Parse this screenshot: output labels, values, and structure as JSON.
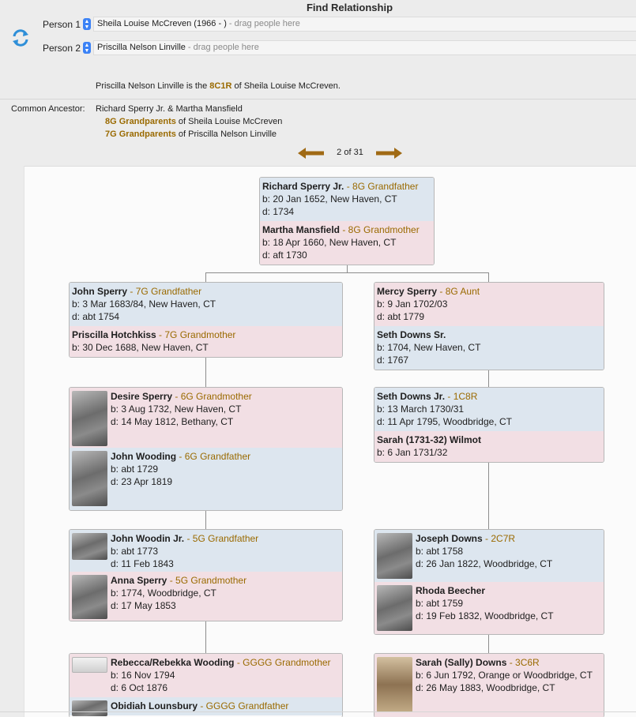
{
  "window": {
    "title": "Find Relationship"
  },
  "people": {
    "person1": {
      "label": "Person 1",
      "name": "Sheila Louise McCreven (1966 - )",
      "hint": " - drag people here"
    },
    "person2": {
      "label": "Person 2",
      "name": "Priscilla Nelson Linville",
      "hint": " - drag people here"
    }
  },
  "relationship": {
    "pre": "Priscilla Nelson Linville is the ",
    "rel": "8C1R",
    "post": " of Sheila Louise McCreven."
  },
  "common": {
    "label": "Common Ancestor:",
    "names": "Richard Sperry Jr. & Martha Mansfield",
    "line1_rel": "8G Grandparents",
    "line1_rest": " of Sheila Louise McCreven",
    "line2_rel": "7G Grandparents",
    "line2_rest": " of Priscilla Nelson Linville"
  },
  "pager": {
    "text": "2 of 31"
  },
  "cards": {
    "top": {
      "p1": {
        "name": "Richard Sperry Jr.",
        "rel": " - 8G Grandfather",
        "b": "b: 20 Jan 1652, New Haven, CT",
        "d": "d: 1734"
      },
      "p2": {
        "name": "Martha Mansfield",
        "rel": " - 8G Grandmother",
        "b": "b: 18 Apr 1660, New Haven, CT",
        "d": "d: aft 1730"
      }
    },
    "l1": {
      "p1": {
        "name": "John Sperry",
        "rel": " - 7G Grandfather",
        "b": "b: 3 Mar 1683/84, New Haven, CT",
        "d": "d: abt 1754"
      },
      "p2": {
        "name": "Priscilla Hotchkiss",
        "rel": " - 7G Grandmother",
        "b": "b: 30 Dec 1688, New Haven, CT"
      }
    },
    "r1": {
      "p1": {
        "name": "Mercy Sperry",
        "rel": " - 8G Aunt",
        "b": "b: 9 Jan 1702/03",
        "d": "d: abt 1779"
      },
      "p2": {
        "name": "Seth Downs Sr.",
        "b": "b: 1704, New Haven, CT",
        "d": "d: 1767"
      }
    },
    "l2": {
      "p1": {
        "name": "Desire Sperry",
        "rel": " - 6G Grandmother",
        "b": "b: 3 Aug 1732, New Haven, CT",
        "d": "d: 14 May 1812, Bethany, CT"
      },
      "p2": {
        "name": "John Wooding",
        "rel": " - 6G Grandfather",
        "b": "b: abt 1729",
        "d": "d: 23 Apr 1819"
      }
    },
    "r2": {
      "p1": {
        "name": "Seth Downs Jr.",
        "rel": " - 1C8R",
        "b": "b: 13 March 1730/31",
        "d": "d: 11 Apr 1795, Woodbridge, CT"
      },
      "p2": {
        "name": "Sarah (1731-32) Wilmot",
        "b": "b: 6 Jan 1731/32"
      }
    },
    "l3": {
      "p1": {
        "name": "John Woodin Jr.",
        "rel": " - 5G Grandfather",
        "b": "b: abt 1773",
        "d": "d: 11 Feb 1843"
      },
      "p2": {
        "name": "Anna Sperry",
        "rel": " - 5G Grandmother",
        "b": "b: 1774, Woodbridge, CT",
        "d": "d: 17 May 1853"
      }
    },
    "r3": {
      "p1": {
        "name": "Joseph Downs",
        "rel": " - 2C7R",
        "b": "b: abt 1758",
        "d": "d: 26 Jan 1822, Woodbridge, CT"
      },
      "p2": {
        "name": "Rhoda Beecher",
        "b": "b: abt 1759",
        "d": "d: 19 Feb 1832, Woodbridge, CT"
      }
    },
    "l4": {
      "p1": {
        "name": "Rebecca/Rebekka Wooding",
        "rel": " - GGGG Grandmother",
        "b": "b: 16 Nov 1794",
        "d": "d: 6 Oct 1876"
      },
      "p2": {
        "name": "Obidiah Lounsbury",
        "rel": " - GGGG Grandfather"
      }
    },
    "r4": {
      "p1": {
        "name": "Sarah (Sally) Downs",
        "rel": " - 3C6R",
        "b": "b: 6 Jun 1792, Orange or Woodbridge, CT",
        "d": "d: 26 May 1883, Woodbridge, CT"
      }
    }
  },
  "colors": {
    "accent": "#9a6a00",
    "male_bg": "#dde6ef",
    "female_bg": "#f2dfe4",
    "arrow": "#a06a14",
    "swap_icon": "#2f8fd8"
  },
  "icons": [
    "refresh-swap-icon",
    "stepper-icon",
    "left-arrow-icon",
    "right-arrow-icon"
  ]
}
